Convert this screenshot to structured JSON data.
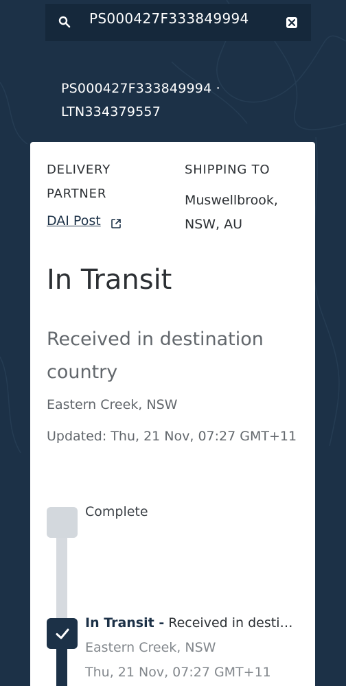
{
  "search": {
    "value": "PS000427F333849994"
  },
  "tracking": {
    "line1": "PS000427F333849994 ·",
    "line2": "LTN334379557"
  },
  "card": {
    "delivery_partner_label_1": "DELIVERY",
    "delivery_partner_label_2": "PARTNER",
    "delivery_partner_link": "DAI Post",
    "shipping_to_label": "SHIPPING TO",
    "shipping_to_line1": "Muswellbrook,",
    "shipping_to_line2": "NSW, AU",
    "status_title": "In Transit",
    "status_desc_line1": "Received in destination",
    "status_desc_line2": "country",
    "location": "Eastern Creek, NSW",
    "updated": "Updated: Thu, 21 Nov, 07:27 GMT+11"
  },
  "timeline": {
    "complete_label": "Complete",
    "event": {
      "status": "In Transit -",
      "desc": " Received in destination country",
      "location": "Eastern Creek, NSW",
      "time": "Thu, 21 Nov, 07:27 GMT+11"
    }
  },
  "icons": {
    "search": "search-icon",
    "clear": "close-icon",
    "external": "external-link-icon",
    "check": "check-icon"
  },
  "colors": {
    "background": "#1c3147",
    "search_bg": "#15283b",
    "card_bg": "#ffffff",
    "timeline_inactive": "#d3d8dd"
  }
}
